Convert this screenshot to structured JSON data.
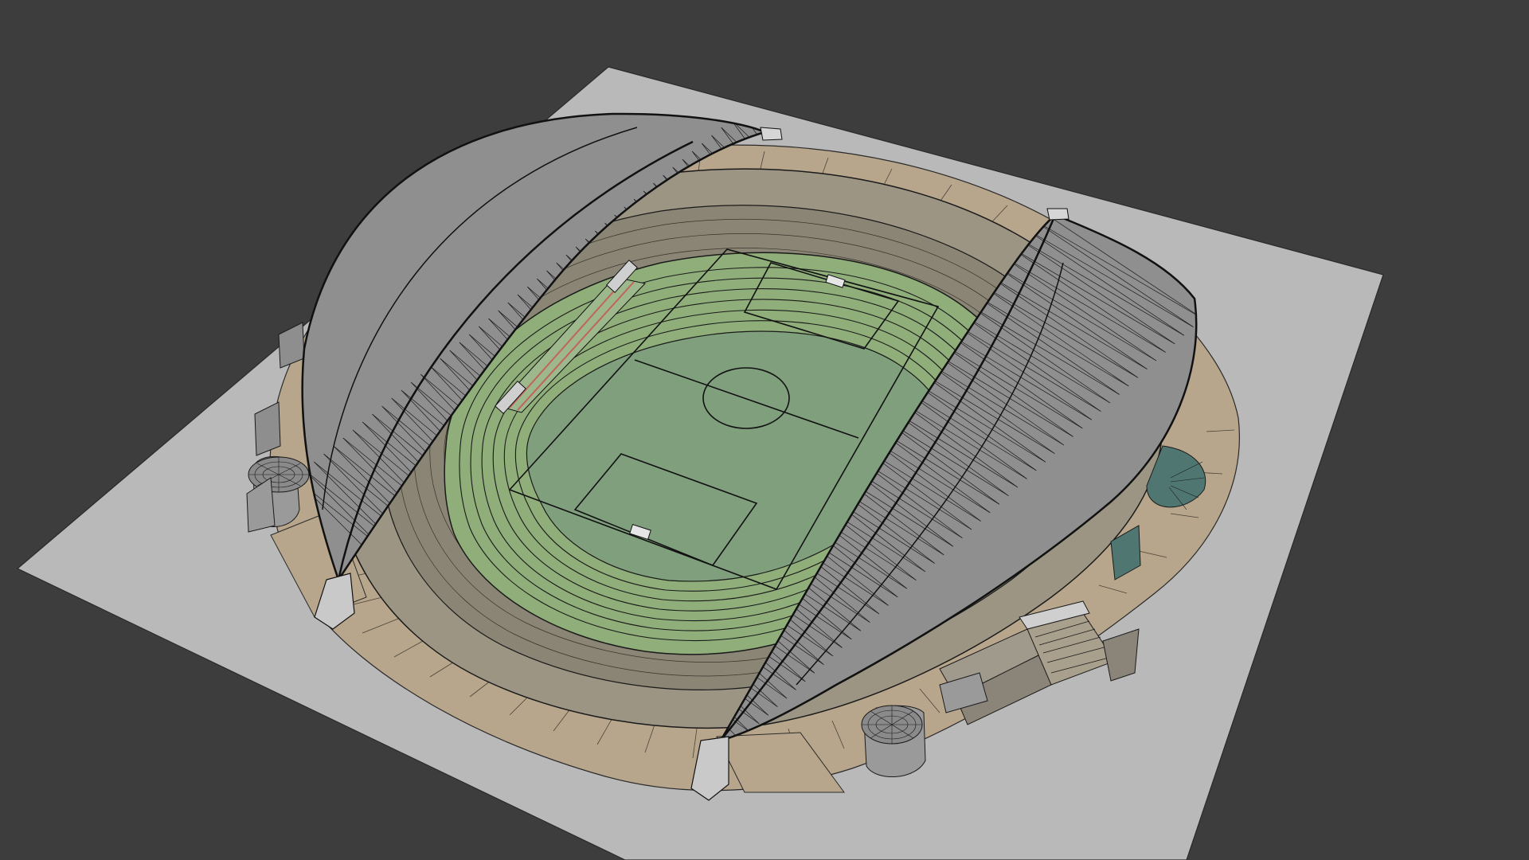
{
  "viewport": {
    "background": "#3d3d3d",
    "shading": "solid-with-wireframe"
  },
  "scene": {
    "object": "stadium-model",
    "colors": {
      "ground_plane": "#b9b9b9",
      "plaza": "#b7a68c",
      "plaza_dark": "#8f8270",
      "seating": "#8a8574",
      "track_outer": "#8fae7a",
      "pitch": "#7f9f7d",
      "roof": "#8f8f8f",
      "roof_light": "#a4a4a4",
      "wire": "#1c1c1c",
      "building": "#9a9a9a",
      "stair_accent": "#4f7670"
    }
  }
}
